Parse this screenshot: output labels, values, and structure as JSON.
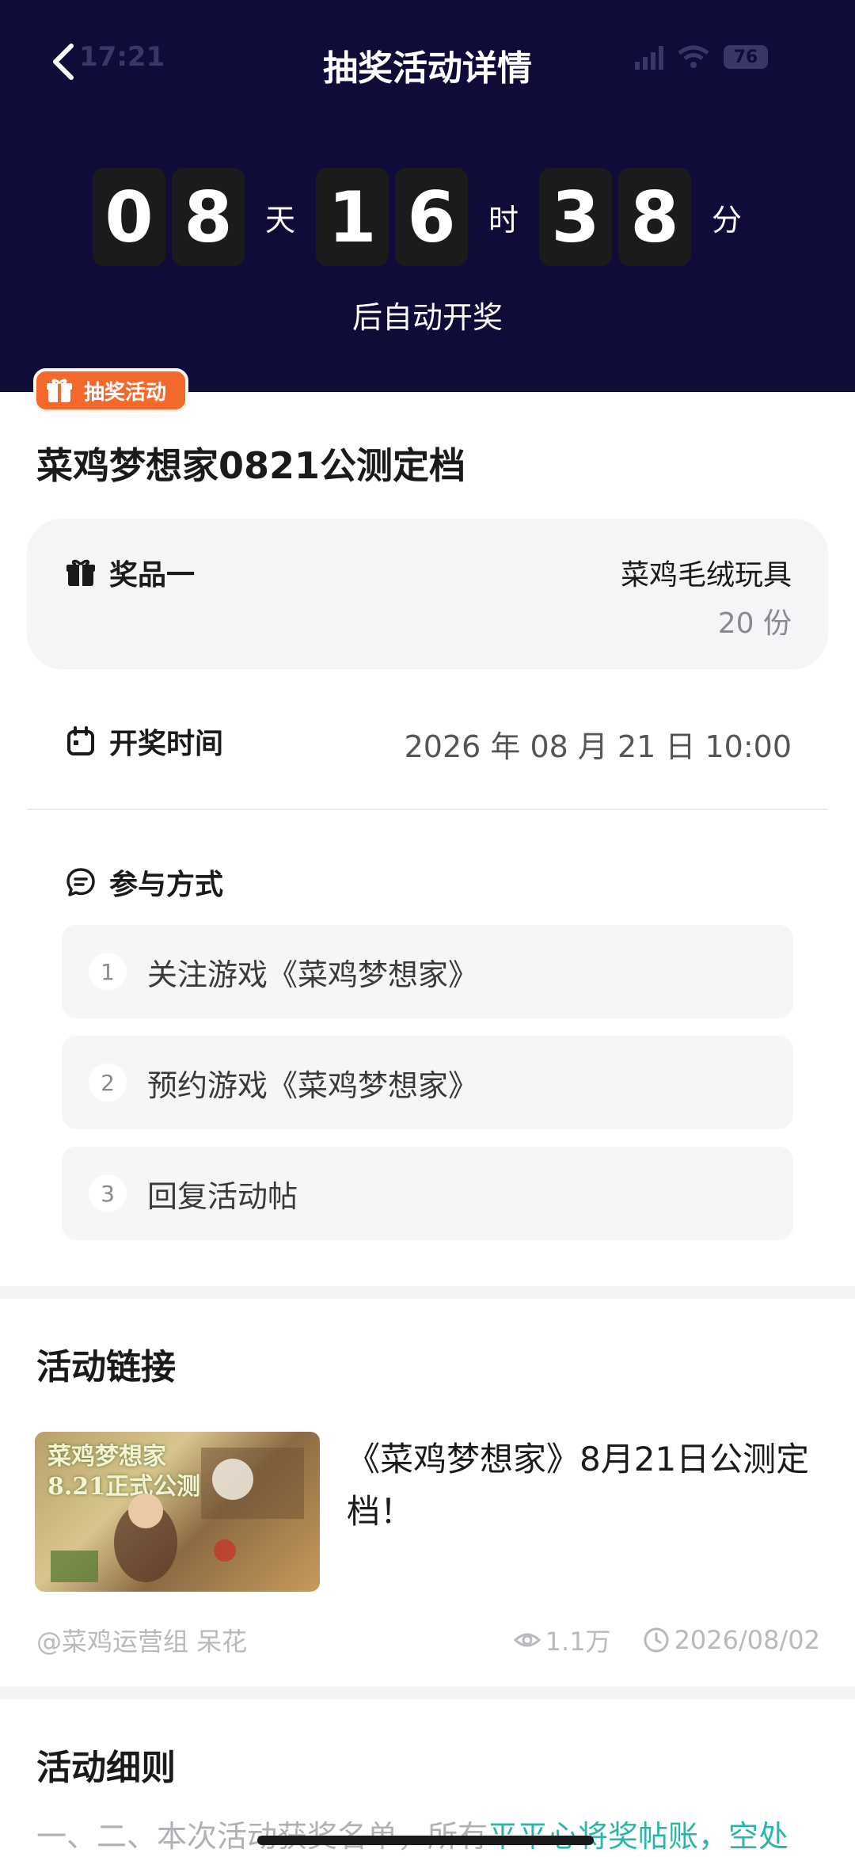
{
  "status_bar": {
    "time": "17:21",
    "battery": "76"
  },
  "header": {
    "title": "抽奖活动详情"
  },
  "countdown": {
    "day_digits": [
      "0",
      "8"
    ],
    "hour_digits": [
      "1",
      "6"
    ],
    "minute_digits": [
      "3",
      "8"
    ],
    "unit_day": "天",
    "unit_hour": "时",
    "unit_minute": "分",
    "subtitle": "后自动开奖"
  },
  "badge": {
    "label": "抽奖活动"
  },
  "event": {
    "title": "菜鸡梦想家0821公测定档"
  },
  "prize": {
    "label": "奖品一",
    "name": "菜鸡毛绒玩具",
    "count": "20 份"
  },
  "draw_time": {
    "label": "开奖时间",
    "value": "2026 年 08 月 21 日 10:00"
  },
  "participation": {
    "label": "参与方式",
    "steps": [
      {
        "num": "1",
        "text": "关注游戏《菜鸡梦想家》"
      },
      {
        "num": "2",
        "text": "预约游戏《菜鸡梦想家》"
      },
      {
        "num": "3",
        "text": "回复活动帖"
      }
    ]
  },
  "activity_link": {
    "section_title": "活动链接",
    "thumb_title": "菜鸡梦想家",
    "thumb_sub": "8.21正式公测",
    "title": "《菜鸡梦想家》8月21日公测定档！",
    "author": "@菜鸡运营组 呆花",
    "views": "1.1万",
    "date": "2026/08/02"
  },
  "rules": {
    "section_title": "活动细则",
    "preview_text": "一、二、本次活动获奖名单，所有",
    "preview_highlight": "平平心将奖帖账，空处"
  },
  "colors": {
    "header_bg": "#100c3a",
    "badge": "#f2692b",
    "link": "#2bb5a8"
  }
}
